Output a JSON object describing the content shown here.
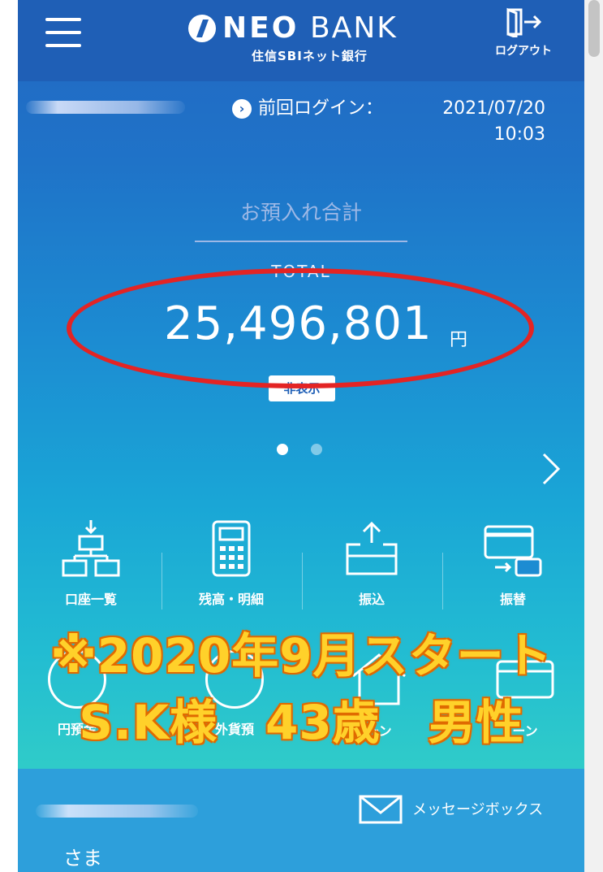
{
  "header": {
    "menu_icon": "hamburger-icon",
    "logo_neo": "NEO",
    "logo_bank": "BANK",
    "logo_subtitle": "住信SBIネット銀行",
    "logout_label": "ログアウト",
    "logout_icon": "logout-door-icon"
  },
  "login": {
    "label": "前回ログイン：",
    "date": "2021/07/20",
    "time": "10:03"
  },
  "balance": {
    "deposit_label": "お預入れ合計",
    "total_label": "TOTAL",
    "amount": "25,496,801",
    "unit": "円",
    "hide_button": "非表示"
  },
  "carousel": {
    "pages": 2,
    "active": 1
  },
  "quick_menu": [
    {
      "label": "口座一覧",
      "icon": "account-list-icon"
    },
    {
      "label": "残高・明細",
      "icon": "calculator-icon"
    },
    {
      "label": "振込",
      "icon": "transfer-icon"
    },
    {
      "label": "振替",
      "icon": "card-transfer-icon"
    }
  ],
  "quick_menu_row2": [
    {
      "label": "円預金",
      "icon": "yen-deposit-icon"
    },
    {
      "label": "外貨預",
      "icon": "foreign-deposit-icon"
    },
    {
      "label": "ーン",
      "icon": "housing-loan-icon"
    },
    {
      "label": "ーン",
      "icon": "card-loan-icon"
    }
  ],
  "overlay": {
    "line1": "※2020年9月スタート",
    "line2": "S.K様　43歳　男性"
  },
  "messages": {
    "label": "メッセージボックス",
    "icon": "envelope-icon"
  },
  "user": {
    "suffix": "さま"
  },
  "colors": {
    "header": "#1f5fb6",
    "highlight": "#e32424",
    "overlay_fill": "#ffd12a",
    "overlay_stroke": "#e06a00"
  }
}
